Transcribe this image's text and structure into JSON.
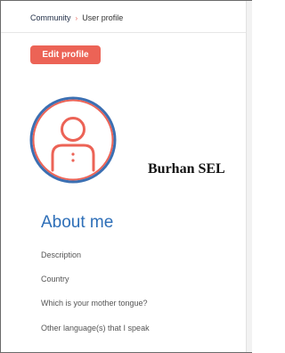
{
  "breadcrumb": {
    "community": "Community",
    "separator": "›",
    "current": "User profile"
  },
  "edit_button": "Edit profile",
  "profile": {
    "name": "Burhan SEL",
    "avatar_icon": "user-avatar-icon"
  },
  "about": {
    "title": "About me",
    "fields": [
      "Description",
      "Country",
      "Which is your mother tongue?",
      "Other language(s) that I speak"
    ]
  },
  "colors": {
    "accent": "#ec6356",
    "heading": "#2e6fb8",
    "avatar_ring": "#3b6fb2"
  }
}
